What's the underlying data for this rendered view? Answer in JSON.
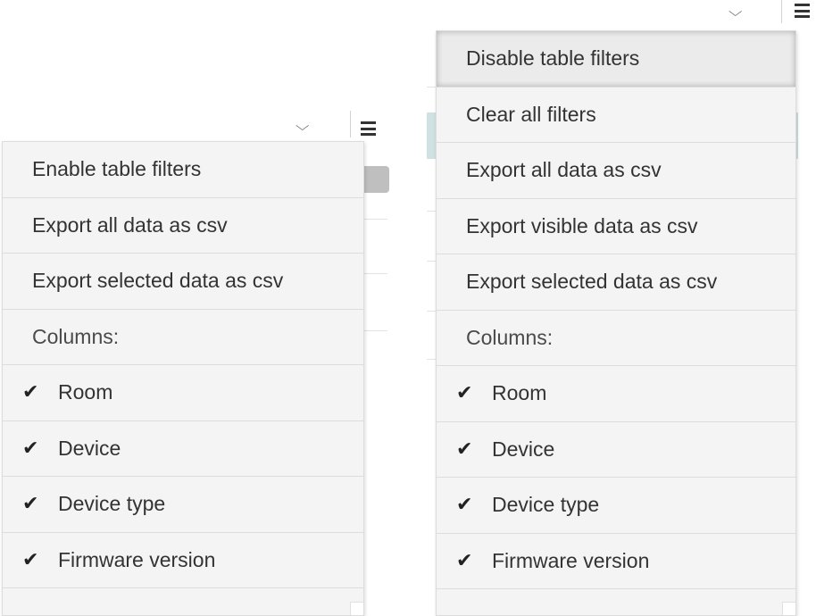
{
  "left_panel": {
    "menu": {
      "items": [
        {
          "label": "Enable table filters"
        },
        {
          "label": "Export all data as csv"
        },
        {
          "label": "Export selected data as csv"
        }
      ],
      "columns_header": "Columns:",
      "columns": [
        {
          "label": "Room",
          "checked": true
        },
        {
          "label": "Device",
          "checked": true
        },
        {
          "label": "Device type",
          "checked": true
        },
        {
          "label": "Firmware version",
          "checked": true
        }
      ]
    }
  },
  "right_panel": {
    "menu": {
      "items": [
        {
          "label": "Disable table filters",
          "active": true
        },
        {
          "label": "Clear all filters"
        },
        {
          "label": "Export all data as csv"
        },
        {
          "label": "Export visible data as csv"
        },
        {
          "label": "Export selected data as csv"
        }
      ],
      "columns_header": "Columns:",
      "columns": [
        {
          "label": "Room",
          "checked": true
        },
        {
          "label": "Device",
          "checked": true
        },
        {
          "label": "Device type",
          "checked": true
        },
        {
          "label": "Firmware version",
          "checked": true
        }
      ]
    }
  },
  "icons": {
    "chevron": "chevron-down-icon",
    "menu": "hamburger-menu-icon",
    "check": "checkmark-icon"
  }
}
